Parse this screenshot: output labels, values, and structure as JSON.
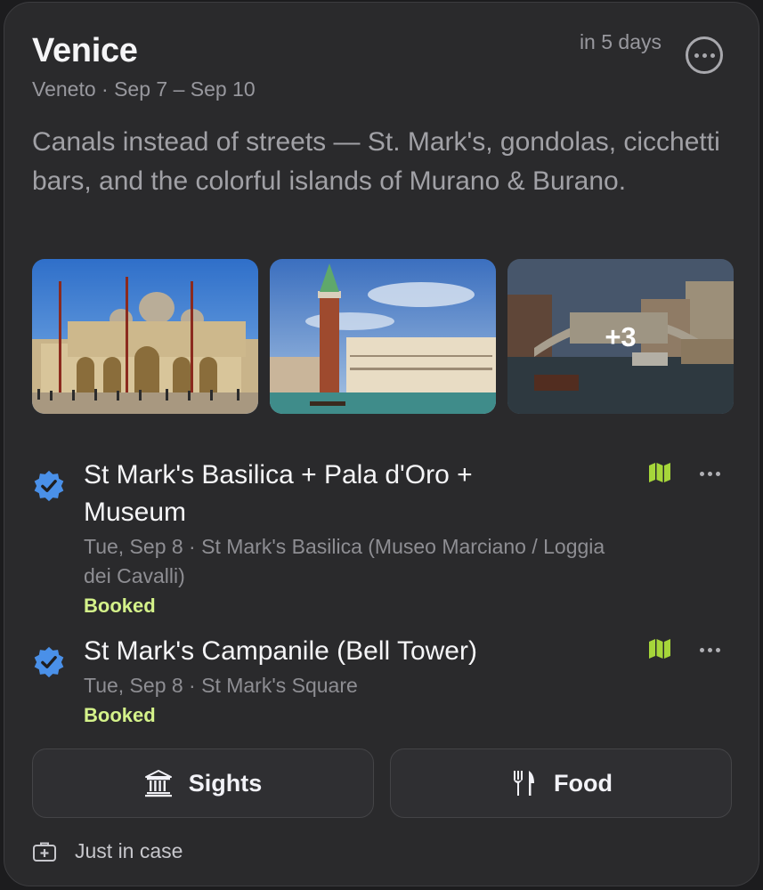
{
  "trip": {
    "title": "Venice",
    "countdown": "in 5 days",
    "subtitle": "Veneto · Sep 7 – Sep 10",
    "description": "Canals instead of streets — St. Mark's, gondolas, cicchetti bars, and the colorful islands of Murano & Burano."
  },
  "gallery": {
    "more_count": "+3",
    "photos": [
      "basilica-photo",
      "campanile-photo",
      "rialto-photo"
    ]
  },
  "itinerary": [
    {
      "name": "St Mark's Basilica + Pala d'Oro + Museum",
      "meta": "Tue, Sep 8 · St Mark's Basilica (Museo Marciano / Loggia dei Cavalli)",
      "status": "Booked"
    },
    {
      "name": "St Mark's Campanile (Bell Tower)",
      "meta": "Tue, Sep 8 · St Mark's Square",
      "status": "Booked"
    }
  ],
  "actions": {
    "sights_label": "Sights",
    "food_label": "Food"
  },
  "footer": {
    "label": "Just in case"
  },
  "colors": {
    "background": "#2a2a2c",
    "verified_badge": "#4a90e8",
    "booked": "#d4f28a",
    "map_icon": "#a6d63a"
  },
  "icons": [
    "more-icon",
    "verified-badge-icon",
    "map-icon",
    "ellipsis-icon",
    "museum-icon",
    "fork-knife-icon",
    "first-aid-kit-icon"
  ]
}
